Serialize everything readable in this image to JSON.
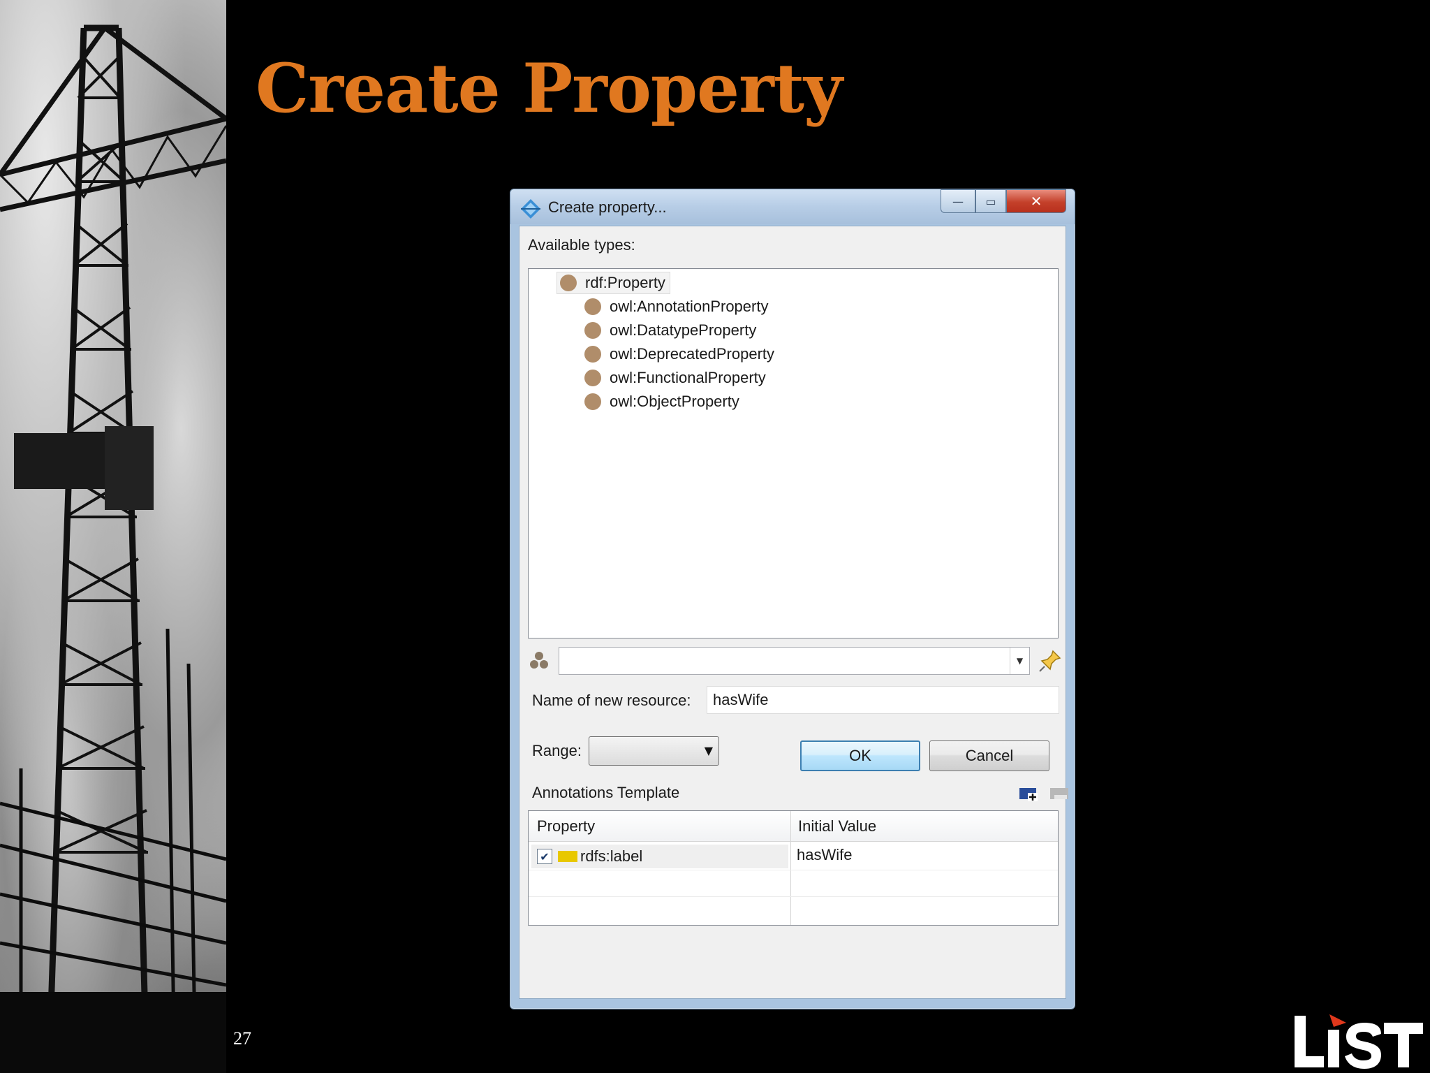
{
  "slide": {
    "title": "Create Property",
    "page_number": "27"
  },
  "dialog": {
    "title": "Create property...",
    "available_types_label": "Available types:",
    "types_root": "rdf:Property",
    "types": [
      "owl:AnnotationProperty",
      "owl:DatatypeProperty",
      "owl:DeprecatedProperty",
      "owl:FunctionalProperty",
      "owl:ObjectProperty"
    ],
    "filter_value": "",
    "name_label": "Name of new resource:",
    "name_value": "hasWife",
    "range_label": "Range:",
    "range_value": "",
    "annotations_label": "Annotations Template",
    "annotations_columns": [
      "Property",
      "Initial Value"
    ],
    "annotations_rows": [
      {
        "checked": true,
        "property": "rdfs:label",
        "initial_value": "hasWife"
      }
    ],
    "ok_label": "OK",
    "cancel_label": "Cancel",
    "minimize_symbol": "—",
    "maximize_symbol": "▭",
    "close_symbol": "✕"
  },
  "colors": {
    "title_orange": "#e07820",
    "type_dot": "#b08d6a",
    "label_swatch": "#e8c800"
  }
}
